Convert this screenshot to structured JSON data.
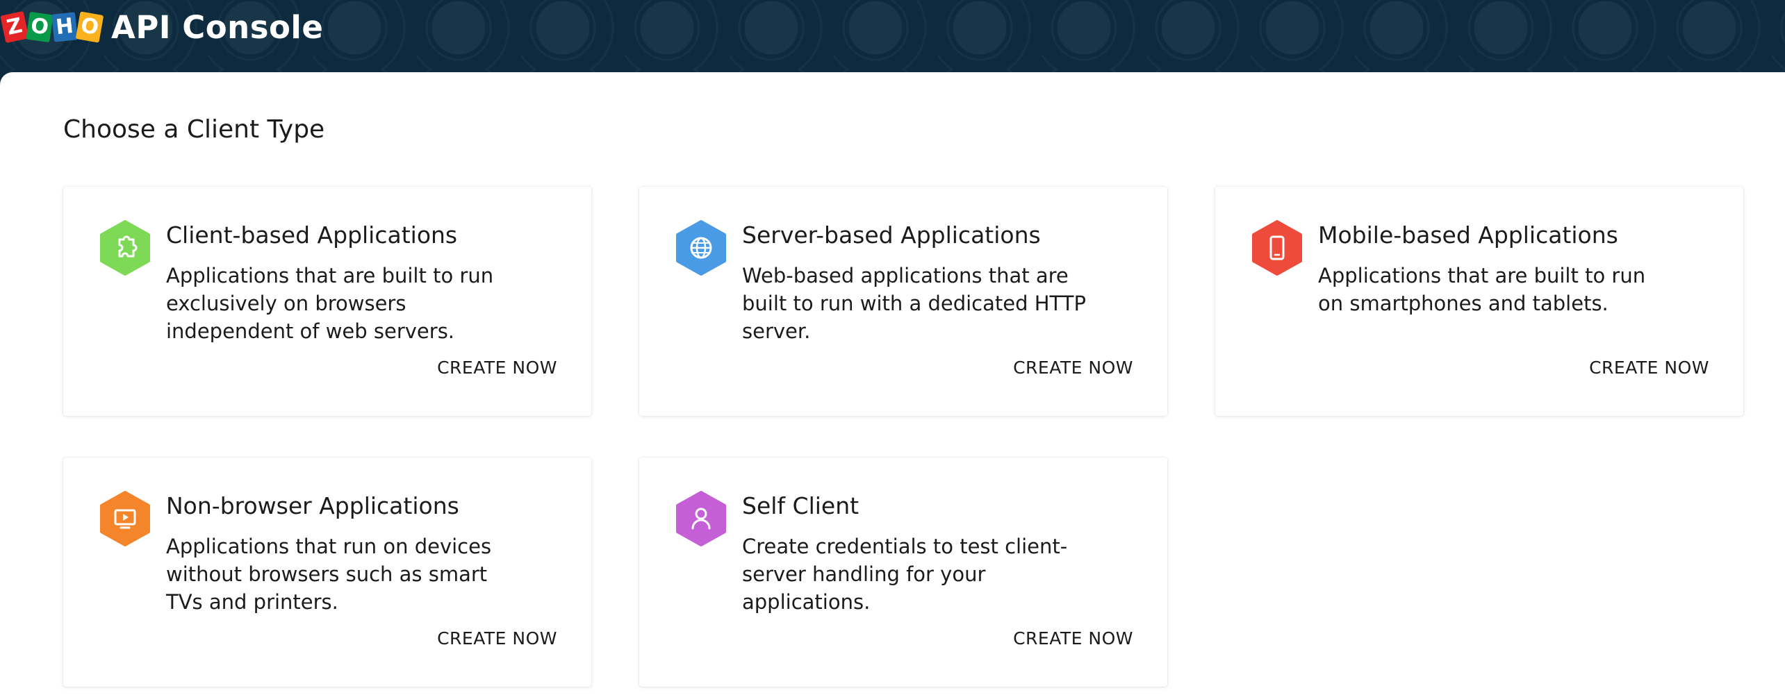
{
  "header": {
    "logo_letters": [
      "Z",
      "O",
      "H",
      "O"
    ],
    "app_title": "API Console"
  },
  "main": {
    "page_title": "Choose a Client Type",
    "cards": [
      {
        "title": "Client-based Applications",
        "description": "Applications that are built to run exclusively on browsers independent of web servers.",
        "action": "CREATE NOW",
        "icon": "puzzle-icon",
        "color": "#7ed957"
      },
      {
        "title": "Server-based Applications",
        "description": "Web-based applications that are built to run with a dedicated HTTP server.",
        "action": "CREATE NOW",
        "icon": "globe-icon",
        "color": "#4a9be6"
      },
      {
        "title": "Mobile-based Applications",
        "description": "Applications that are built to run on smartphones and tablets.",
        "action": "CREATE NOW",
        "icon": "mobile-phone-icon",
        "color": "#ee4b3c"
      },
      {
        "title": "Non-browser Applications",
        "description": "Applications that run on devices without browsers such as smart TVs and printers.",
        "action": "CREATE NOW",
        "icon": "tv-icon",
        "color": "#f5852a"
      },
      {
        "title": "Self Client",
        "description": "Create credentials to test client-server handling for your applications.",
        "action": "CREATE NOW",
        "icon": "user-icon",
        "color": "#c55fd6"
      }
    ]
  }
}
